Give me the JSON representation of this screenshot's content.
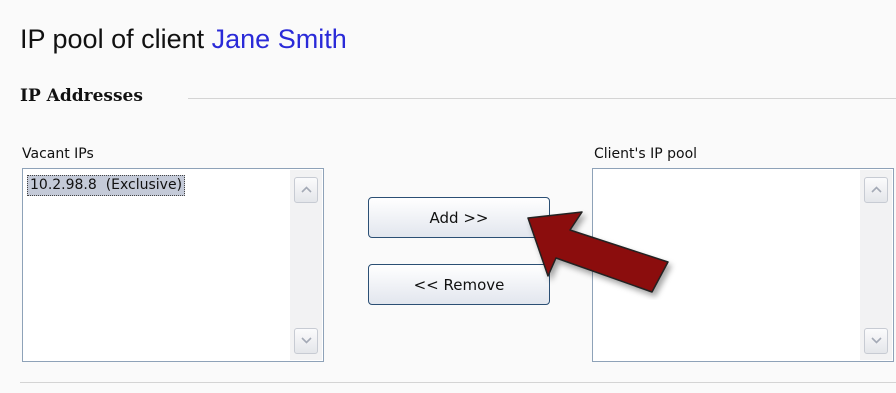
{
  "header": {
    "title_prefix": "IP pool of client",
    "client_name": "Jane Smith"
  },
  "section": {
    "title": "IP Addresses"
  },
  "vacant": {
    "label": "Vacant IPs",
    "items": [
      "10.2.98.8  (Exclusive)"
    ],
    "selected_index": 0
  },
  "pool": {
    "label": "Client's IP pool",
    "items": []
  },
  "buttons": {
    "add_label": "Add >>",
    "remove_label": "<< Remove"
  },
  "colors": {
    "client_name": "#2a2ad8",
    "arrow": "#8b0a0a"
  },
  "icons": {
    "scroll_up": "chevron-up-icon",
    "scroll_down": "chevron-down-icon",
    "pointer": "arrow-pointer-icon"
  }
}
